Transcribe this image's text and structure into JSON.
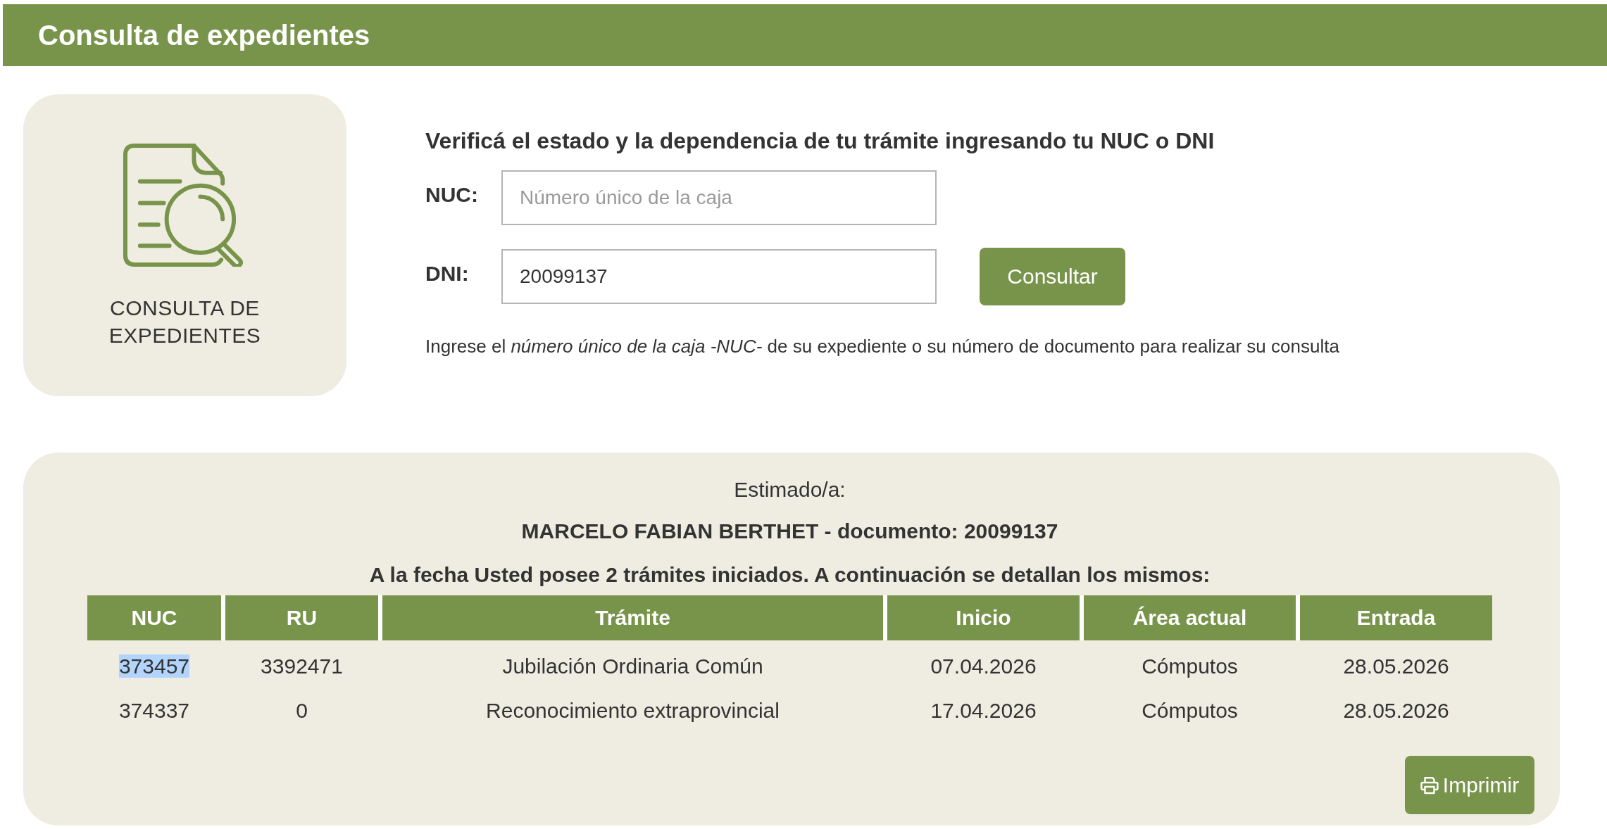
{
  "header": {
    "title": "Consulta de expedientes"
  },
  "side_card": {
    "label": "CONSULTA DE EXPEDIENTES"
  },
  "form": {
    "heading": "Verificá el estado y la dependencia de tu trámite ingresando tu NUC o DNI",
    "fields": [
      {
        "label": "NUC:",
        "placeholder": "Número único de la caja"
      },
      {
        "label": "DNI:",
        "value": "20099137"
      }
    ],
    "submit_button": "Consultar",
    "note": "Ingrese el *número único de la caja -NUC-* de su expediente o su número de documento para realizar su consulta"
  },
  "results": {
    "greeting": "Estimado/a:",
    "person": "MARCELO FABIAN BERTHET - documento: 20099137",
    "summary": "A la fecha Usted posee 2 trámites iniciados. A continuación se detallan los mismos:",
    "table": {
      "columns": [
        "NUC",
        "RU",
        "Trámite",
        "Inicio",
        "Área actual",
        "Entrada"
      ],
      "rows": [
        {
          "cells": [
            "373457",
            "3392471",
            "Jubilación Ordinaria Común",
            "07.04.2026",
            "Cómputos",
            "28.05.2026"
          ],
          "nuc_highlighted": true
        },
        {
          "cells": [
            "374337",
            "0",
            "Reconocimiento extraprovincial",
            "17.04.2026",
            "Cómputos",
            "28.05.2026"
          ],
          "nuc_highlighted": false
        }
      ]
    },
    "print_button": "Imprimir"
  }
}
